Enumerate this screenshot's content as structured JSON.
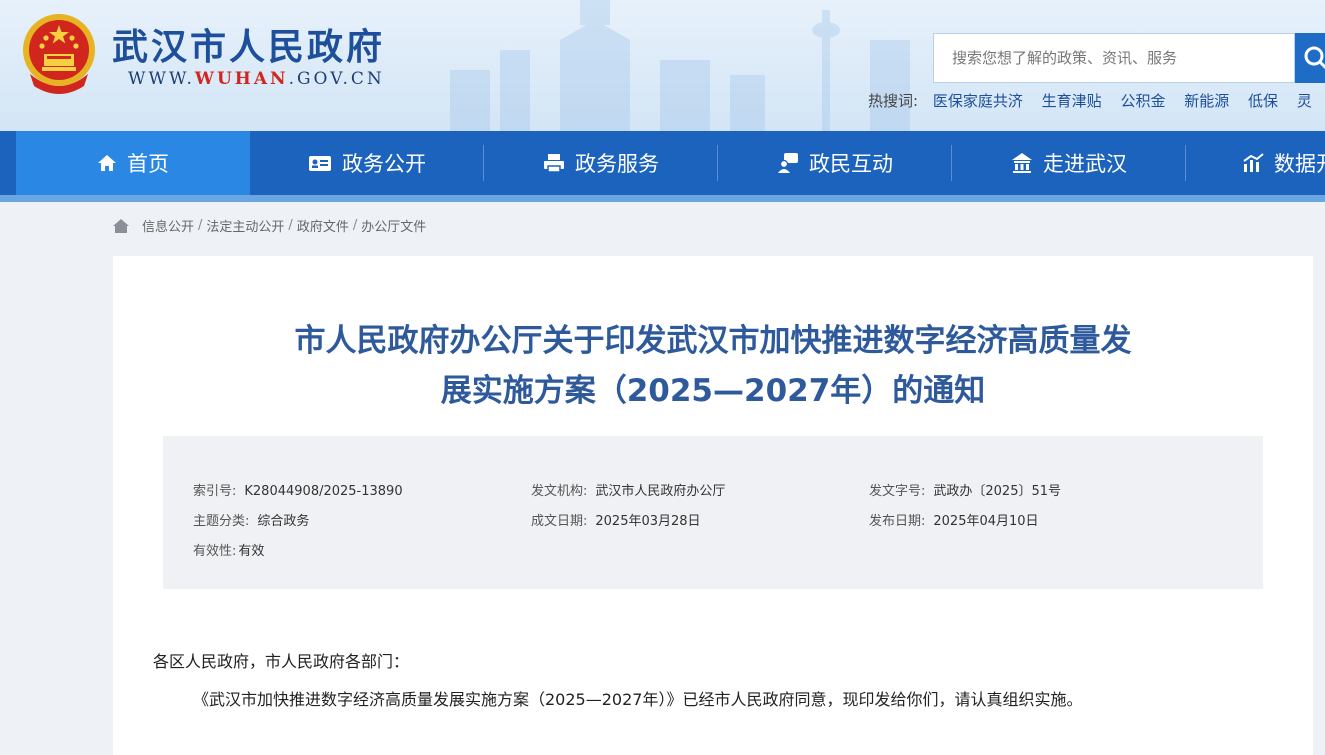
{
  "header": {
    "site_title": "武汉市人民政府",
    "url_prefix": "WWW.",
    "url_highlight": "WUHAN",
    "url_suffix": ".GOV.CN",
    "search_placeholder": "搜索您想了解的政策、资讯、服务",
    "hot_label": "热搜词:",
    "hot_keywords": [
      "医保家庭共济",
      "生育津贴",
      "公积金",
      "新能源",
      "低保",
      "灵"
    ]
  },
  "nav": {
    "items": [
      {
        "label": "首页",
        "icon": "home-icon"
      },
      {
        "label": "政务公开",
        "icon": "id-card-icon"
      },
      {
        "label": "政务服务",
        "icon": "printer-icon"
      },
      {
        "label": "政民互动",
        "icon": "chat-user-icon"
      },
      {
        "label": "走进武汉",
        "icon": "building-icon"
      },
      {
        "label": "数据开",
        "icon": "chart-icon"
      }
    ],
    "active_index": 0
  },
  "breadcrumb": [
    "信息公开",
    "法定主动公开",
    "政府文件",
    "办公厅文件"
  ],
  "document": {
    "title_line1": "市人民政府办公厅关于印发武汉市加快推进数字经济高质量发",
    "title_line2": "展实施方案（2025—2027年）的通知",
    "meta": {
      "index_no": {
        "label": "索引号:",
        "value": "K28044908/2025-13890"
      },
      "issuer": {
        "label": "发文机构:",
        "value": "武汉市人民政府办公厅"
      },
      "doc_no": {
        "label": "发文字号:",
        "value": "武政办〔2025〕51号"
      },
      "topic": {
        "label": "主题分类:",
        "value": "综合政务"
      },
      "created": {
        "label": "成文日期:",
        "value": "2025年03月28日"
      },
      "published": {
        "label": "发布日期:",
        "value": "2025年04月10日"
      },
      "validity": {
        "label": "有效性:",
        "value": "有效"
      }
    },
    "salutation": "各区人民政府，市人民政府各部门：",
    "body": "《武汉市加快推进数字经济高质量发展实施方案（2025—2027年）》已经市人民政府同意，现印发给你们，请认真组织实施。"
  },
  "colors": {
    "nav_bg": "#1b63bd",
    "nav_active": "#2a87e4",
    "title_blue": "#2e5a9c",
    "brand_red": "#d0261d"
  }
}
